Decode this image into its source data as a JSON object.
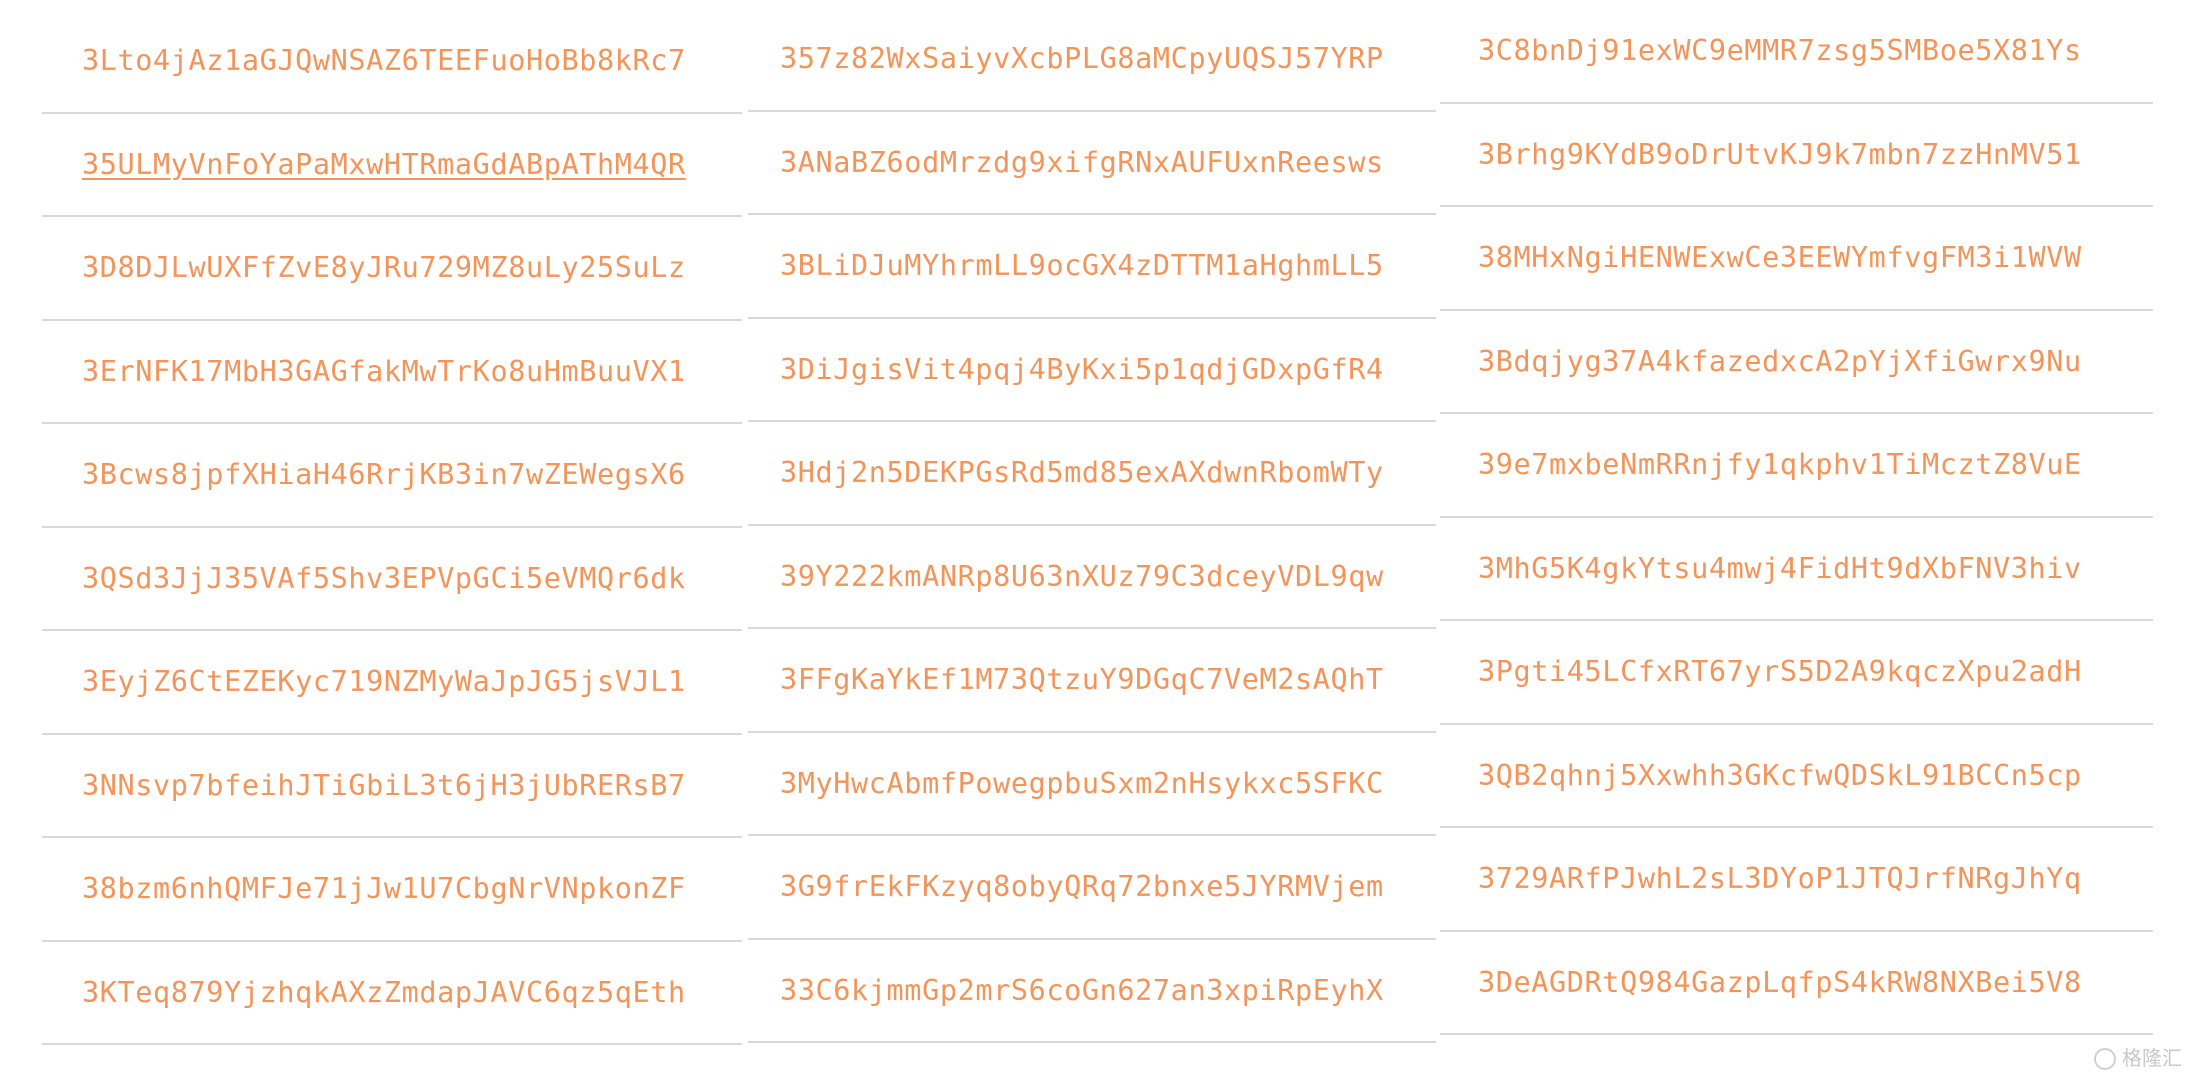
{
  "colors": {
    "address": "#f2955b",
    "divider": "#d9d9d9",
    "background": "#ffffff"
  },
  "columns": [
    [
      "3Lto4jAz1aGJQwNSAZ6TEEFuoHoBb8kRc7",
      "35ULMyVnFoYaPaMxwHTRmaGdABpAThM4QR",
      "3D8DJLwUXFfZvE8yJRu729MZ8uLy25SuLz",
      "3ErNFK17MbH3GAGfakMwTrKo8uHmBuuVX1",
      "3Bcws8jpfXHiaH46RrjKB3in7wZEWegsX6",
      "3QSd3JjJ35VAf5Shv3EPVpGCi5eVMQr6dk",
      "3EyjZ6CtEZEKyc719NZMyWaJpJG5jsVJL1",
      "3NNsvp7bfeihJTiGbiL3t6jH3jUbRERsB7",
      "38bzm6nhQMFJe71jJw1U7CbgNrVNpkonZF",
      "3KTeq879YjzhqkAXzZmdapJAVC6qz5qEth"
    ],
    [
      "357z82WxSaiyvXcbPLG8aMCpyUQSJ57YRP",
      "3ANaBZ6odMrzdg9xifgRNxAUFUxnReesws",
      "3BLiDJuMYhrmLL9ocGX4zDTTM1aHghmLL5",
      "3DiJgisVit4pqj4ByKxi5p1qdjGDxpGfR4",
      "3Hdj2n5DEKPGsRd5md85exAXdwnRbomWTy",
      "39Y222kmANRp8U63nXUz79C3dceyVDL9qw",
      "3FFgKaYkEf1M73QtzuY9DGqC7VeM2sAQhT",
      "3MyHwcAbmfPowegpbuSxm2nHsykxc5SFKC",
      "3G9frEkFKzyq8obyQRq72bnxe5JYRMVjem",
      "33C6kjmmGp2mrS6coGn627an3xpiRpEyhX"
    ],
    [
      "3C8bnDj91exWC9eMMR7zsg5SMBoe5X81Ys",
      "3Brhg9KYdB9oDrUtvKJ9k7mbn7zzHnMV51",
      "38MHxNgiHENWExwCe3EEWYmfvgFM3i1WVW",
      "3Bdqjyg37A4kfazedxcA2pYjXfiGwrx9Nu",
      "39e7mxbeNmRRnjfy1qkphv1TiMcztZ8VuE",
      "3MhG5K4gkYtsu4mwj4FidHt9dXbFNV3hiv",
      "3Pgti45LCfxRT67yrS5D2A9kqczXpu2adH",
      "3QB2qhnj5Xxwhh3GKcfwQDSkL91BCCn5cp",
      "3729ARfPJwhL2sL3DYoP1JTQJrfNRgJhYq",
      "3DeAGDRtQ984GazpLqfpS4kRW8NXBei5V8"
    ]
  ],
  "hovered": {
    "column": 0,
    "row": 1
  },
  "watermark": {
    "icon": "circle-logo-icon",
    "text": "格隆汇"
  }
}
